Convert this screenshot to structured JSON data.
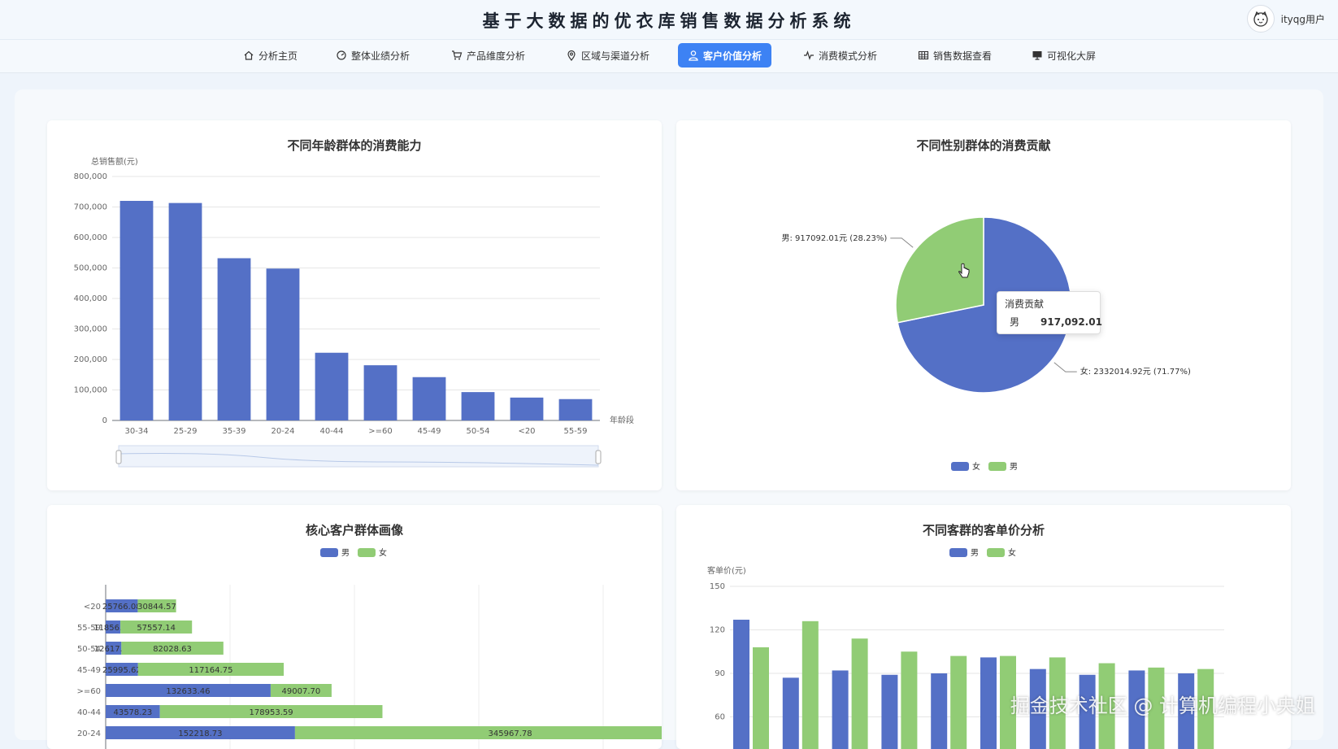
{
  "header": {
    "title": "基于大数据的优衣库销售数据分析系统",
    "user_name": "ityqg用户"
  },
  "nav": {
    "items": [
      {
        "label": "分析主页",
        "icon": "home-icon"
      },
      {
        "label": "整体业绩分析",
        "icon": "gauge-icon"
      },
      {
        "label": "产品维度分析",
        "icon": "cart-icon"
      },
      {
        "label": "区域与渠道分析",
        "icon": "location-pin-icon"
      },
      {
        "label": "客户价值分析",
        "icon": "user-icon",
        "active": true
      },
      {
        "label": "消费模式分析",
        "icon": "pulse-icon"
      },
      {
        "label": "销售数据查看",
        "icon": "table-icon"
      },
      {
        "label": "可视化大屏",
        "icon": "monitor-icon"
      }
    ]
  },
  "colors": {
    "primary": "#5470c6",
    "secondary": "#91cc75",
    "accent": "#3d82f4"
  },
  "chart_data": [
    {
      "type": "bar",
      "title": "不同年龄群体的消费能力",
      "ylabel": "总销售额(元)",
      "xlabel": "年龄段",
      "categories": [
        "30-34",
        "25-29",
        "35-39",
        "20-24",
        "40-44",
        ">=60",
        "45-49",
        "50-54",
        "<20",
        "55-59"
      ],
      "values": [
        720000,
        713000,
        532000,
        498000,
        222000,
        181000,
        142000,
        93000,
        75000,
        70000
      ],
      "ylim": [
        0,
        800000
      ],
      "yticks": [
        "800,000",
        "700,000",
        "600,000",
        "500,000",
        "400,000",
        "300,000",
        "200,000",
        "100,000",
        "0"
      ],
      "datazoom": true
    },
    {
      "type": "pie",
      "title": "不同性别群体的消费贡献",
      "slices": [
        {
          "name": "女",
          "value": 2332014.92,
          "label": "女: 2332014.92元 (71.77%)"
        },
        {
          "name": "男",
          "value": 917092.01,
          "label": "男: 917092.01元 (28.23%)"
        }
      ],
      "legend": [
        "女",
        "男"
      ],
      "tooltip": {
        "title": "消费贡献",
        "name": "男",
        "value": "917,092.01"
      }
    },
    {
      "type": "bar",
      "orientation": "horizontal",
      "stacked": true,
      "title": "核心客户群体画像",
      "legend": [
        "男",
        "女"
      ],
      "categories": [
        "20-24",
        "40-44",
        ">=60",
        "45-49",
        "50-54",
        "55-59",
        "<20"
      ],
      "series": [
        {
          "name": "男",
          "values": [
            152218.73,
            43578.23,
            132633.46,
            25995.62,
            12617.82,
            11856.75,
            25766.08
          ],
          "labels": [
            "152218.73",
            "43578.23",
            "132633.46",
            "25995.62",
            "12617.82",
            "11856.75",
            "25766.08"
          ]
        },
        {
          "name": "女",
          "values": [
            345967.78,
            178953.59,
            49007.7,
            117164.75,
            82028.63,
            57557.14,
            30844.57
          ],
          "labels": [
            "345967.78",
            "178953.59",
            "49007.70",
            "117164.75",
            "82028.63",
            "57557.14",
            "30844.57"
          ]
        }
      ],
      "xmax": 400000
    },
    {
      "type": "bar",
      "title": "不同客群的客单价分析",
      "ylabel": "客单价(元)",
      "legend": [
        "男",
        "女"
      ],
      "yticks": [
        "150",
        "120",
        "90",
        "60"
      ],
      "series": [
        {
          "name": "男",
          "values": [
            127,
            87,
            92,
            89,
            90,
            101,
            93,
            89,
            92,
            90
          ]
        },
        {
          "name": "女",
          "values": [
            108,
            126,
            114,
            105,
            102,
            102,
            101,
            97,
            94,
            93
          ]
        }
      ]
    }
  ],
  "watermark": "掘金技术社区 @ 计算机编程小央姐"
}
